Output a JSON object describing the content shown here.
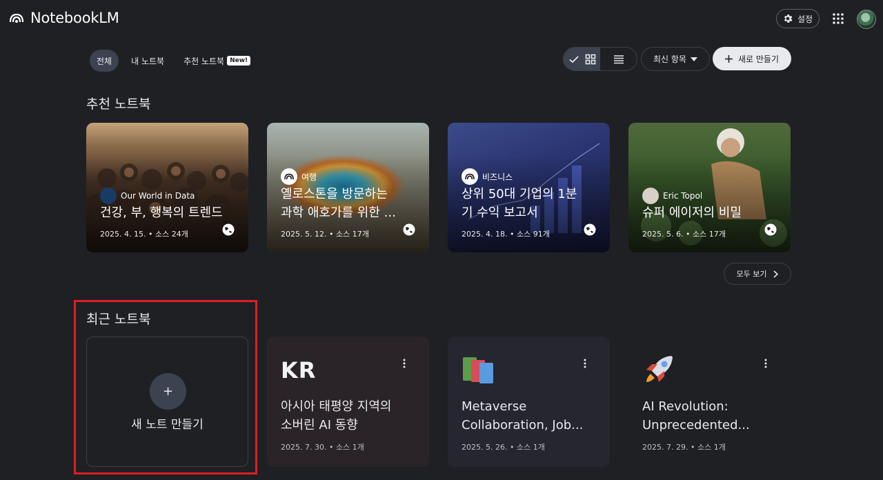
{
  "header": {
    "app_name": "NotebookLM",
    "settings_label": "설정"
  },
  "filters": {
    "all": "전체",
    "mine": "내 노트북",
    "featured": "추천 노트북",
    "new_badge": "New!"
  },
  "toolbar": {
    "sort_label": "최신 항목",
    "create_label": "새로 만들기"
  },
  "featured": {
    "title": "추천 노트북",
    "see_all": "모두 보기",
    "items": [
      {
        "source": "Our World in Data",
        "title_line1": "건강, 부, 행복의 트렌드",
        "title_line2": "",
        "meta": "2025. 4. 15. • 소스 24개"
      },
      {
        "source": "여행",
        "title_line1": "옐로스톤을 방문하는",
        "title_line2": "과학 애호가를 위한 ...",
        "meta": "2025. 5. 12. • 소스 17개"
      },
      {
        "source": "비즈니스",
        "title_line1": "상위 50대 기업의 1분",
        "title_line2": "기 수익 보고서",
        "meta": "2025. 4. 18. • 소스 91개"
      },
      {
        "source": "Eric Topol",
        "title_line1": "슈퍼 에이저의 비밀",
        "title_line2": "",
        "meta": "2025. 5. 6. • 소스 17개"
      }
    ]
  },
  "recent": {
    "title": "최근 노트북",
    "new_notebook_label": "새 노트 만들기",
    "items": [
      {
        "emoji": "KR",
        "title_line1": "아시아 태평양 지역의",
        "title_line2": "소버린 AI 동향",
        "meta": "2025. 7. 30. • 소스 1개"
      },
      {
        "emoji": "📚",
        "title_line1": "Metaverse",
        "title_line2": "Collaboration, Job...",
        "meta": "2025. 5. 26. • 소스 1개"
      },
      {
        "emoji": "🚀",
        "title_line1": "AI Revolution:",
        "title_line2": "Unprecedented...",
        "meta": "2025. 7. 29. • 소스 1개"
      }
    ]
  },
  "colors": {
    "background": "#1f2024",
    "highlight": "#e01e24"
  }
}
